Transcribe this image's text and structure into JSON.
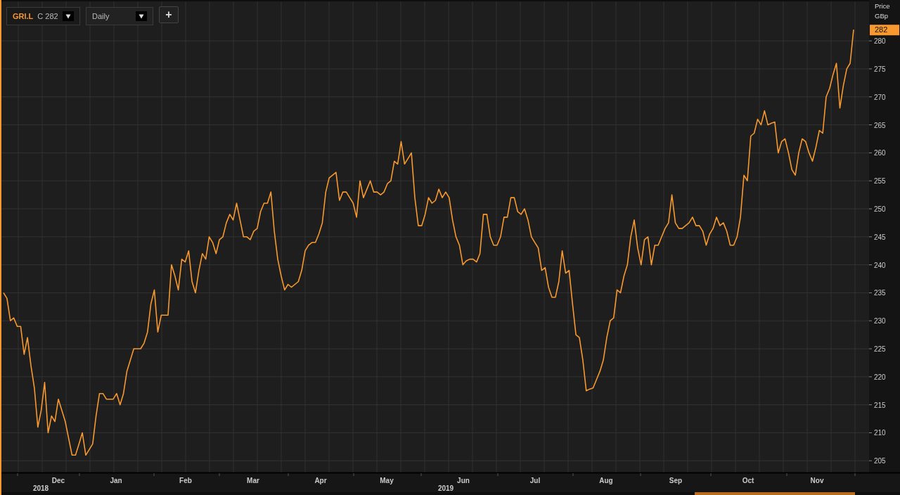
{
  "toolbar": {
    "symbol": "GRI.L",
    "quote": "C 282",
    "interval": "Daily",
    "add_button": "+"
  },
  "price_axis": {
    "title": "Price",
    "unit": "GBp",
    "last_value": "282"
  },
  "time_axis": [
    {
      "month": "Dec",
      "year": "2018"
    },
    {
      "month": "Jan"
    },
    {
      "month": "Feb"
    },
    {
      "month": "Mar"
    },
    {
      "month": "Apr"
    },
    {
      "month": "May"
    },
    {
      "month": "Jun",
      "year": "2019"
    },
    {
      "month": "Jul"
    },
    {
      "month": "Aug"
    },
    {
      "month": "Sep"
    },
    {
      "month": "Oct"
    },
    {
      "month": "Nov"
    }
  ],
  "chart_data": {
    "type": "line",
    "ylim": [
      202.9,
      287.3
    ],
    "grid": true,
    "yticks": [
      205,
      210,
      215,
      220,
      225,
      230,
      235,
      240,
      245,
      250,
      255,
      260,
      265,
      270,
      275,
      280
    ],
    "series": [
      {
        "color": "#f7992f",
        "values": [
          235,
          234,
          230,
          230.5,
          229,
          229,
          224,
          227,
          222,
          218,
          211,
          214,
          219,
          210,
          213,
          212,
          216,
          214,
          212,
          209,
          206,
          206,
          208,
          210,
          206,
          207,
          208,
          213,
          217,
          217,
          216,
          216,
          216,
          217,
          215,
          217,
          221,
          223,
          225,
          225,
          225,
          226,
          228,
          233,
          235.5,
          228,
          231,
          231,
          231,
          240,
          238,
          235.5,
          241,
          240.5,
          242.5,
          237,
          235,
          239,
          242,
          241,
          245,
          244,
          242,
          244.5,
          245,
          247.5,
          249,
          248,
          251,
          248,
          245,
          245,
          244.5,
          246,
          246.5,
          249.5,
          251,
          251,
          253,
          246,
          241,
          238,
          235.5,
          236.5,
          236,
          236.5,
          237,
          239,
          242.5,
          243.5,
          244,
          244,
          245.5,
          247.5,
          253,
          255.5,
          256,
          256.5,
          251.5,
          253,
          253,
          252,
          251,
          248.5,
          255,
          252,
          253.5,
          255,
          253,
          253,
          252.5,
          253,
          254.5,
          255,
          258.5,
          258,
          262,
          258,
          259,
          260,
          252,
          247,
          247,
          249,
          252,
          251,
          251.5,
          253.5,
          252,
          253,
          252,
          248,
          245,
          243.5,
          240,
          240.7,
          241,
          241,
          240.5,
          242,
          249,
          249,
          245,
          243.5,
          243.5,
          245,
          248.5,
          248.5,
          252,
          252,
          249.5,
          249,
          250,
          248,
          245,
          244,
          243,
          239,
          239.5,
          236,
          234.2,
          234.2,
          237,
          242.5,
          238.5,
          239,
          233,
          227.5,
          227,
          223,
          217.5,
          217.8,
          218,
          219.5,
          221,
          223,
          227,
          230,
          230.5,
          235.5,
          235,
          238,
          240,
          245,
          248,
          243,
          240,
          244.5,
          245,
          240,
          243.5,
          243.5,
          245,
          246.5,
          247.5,
          252.5,
          247.5,
          246.5,
          246.5,
          247,
          247.5,
          248.5,
          247,
          247,
          246,
          243.5,
          245.5,
          246.5,
          248.5,
          247,
          247.5,
          246,
          243.5,
          243.5,
          245,
          248.5,
          256,
          255,
          263,
          263.5,
          266,
          265,
          267.5,
          265,
          265.3,
          265.5,
          260,
          262,
          262.5,
          260,
          257,
          256,
          260,
          262.5,
          262,
          260,
          258.5,
          261,
          264,
          263.5,
          270,
          271.5,
          274,
          276,
          268,
          272,
          275,
          276,
          282
        ]
      }
    ]
  }
}
